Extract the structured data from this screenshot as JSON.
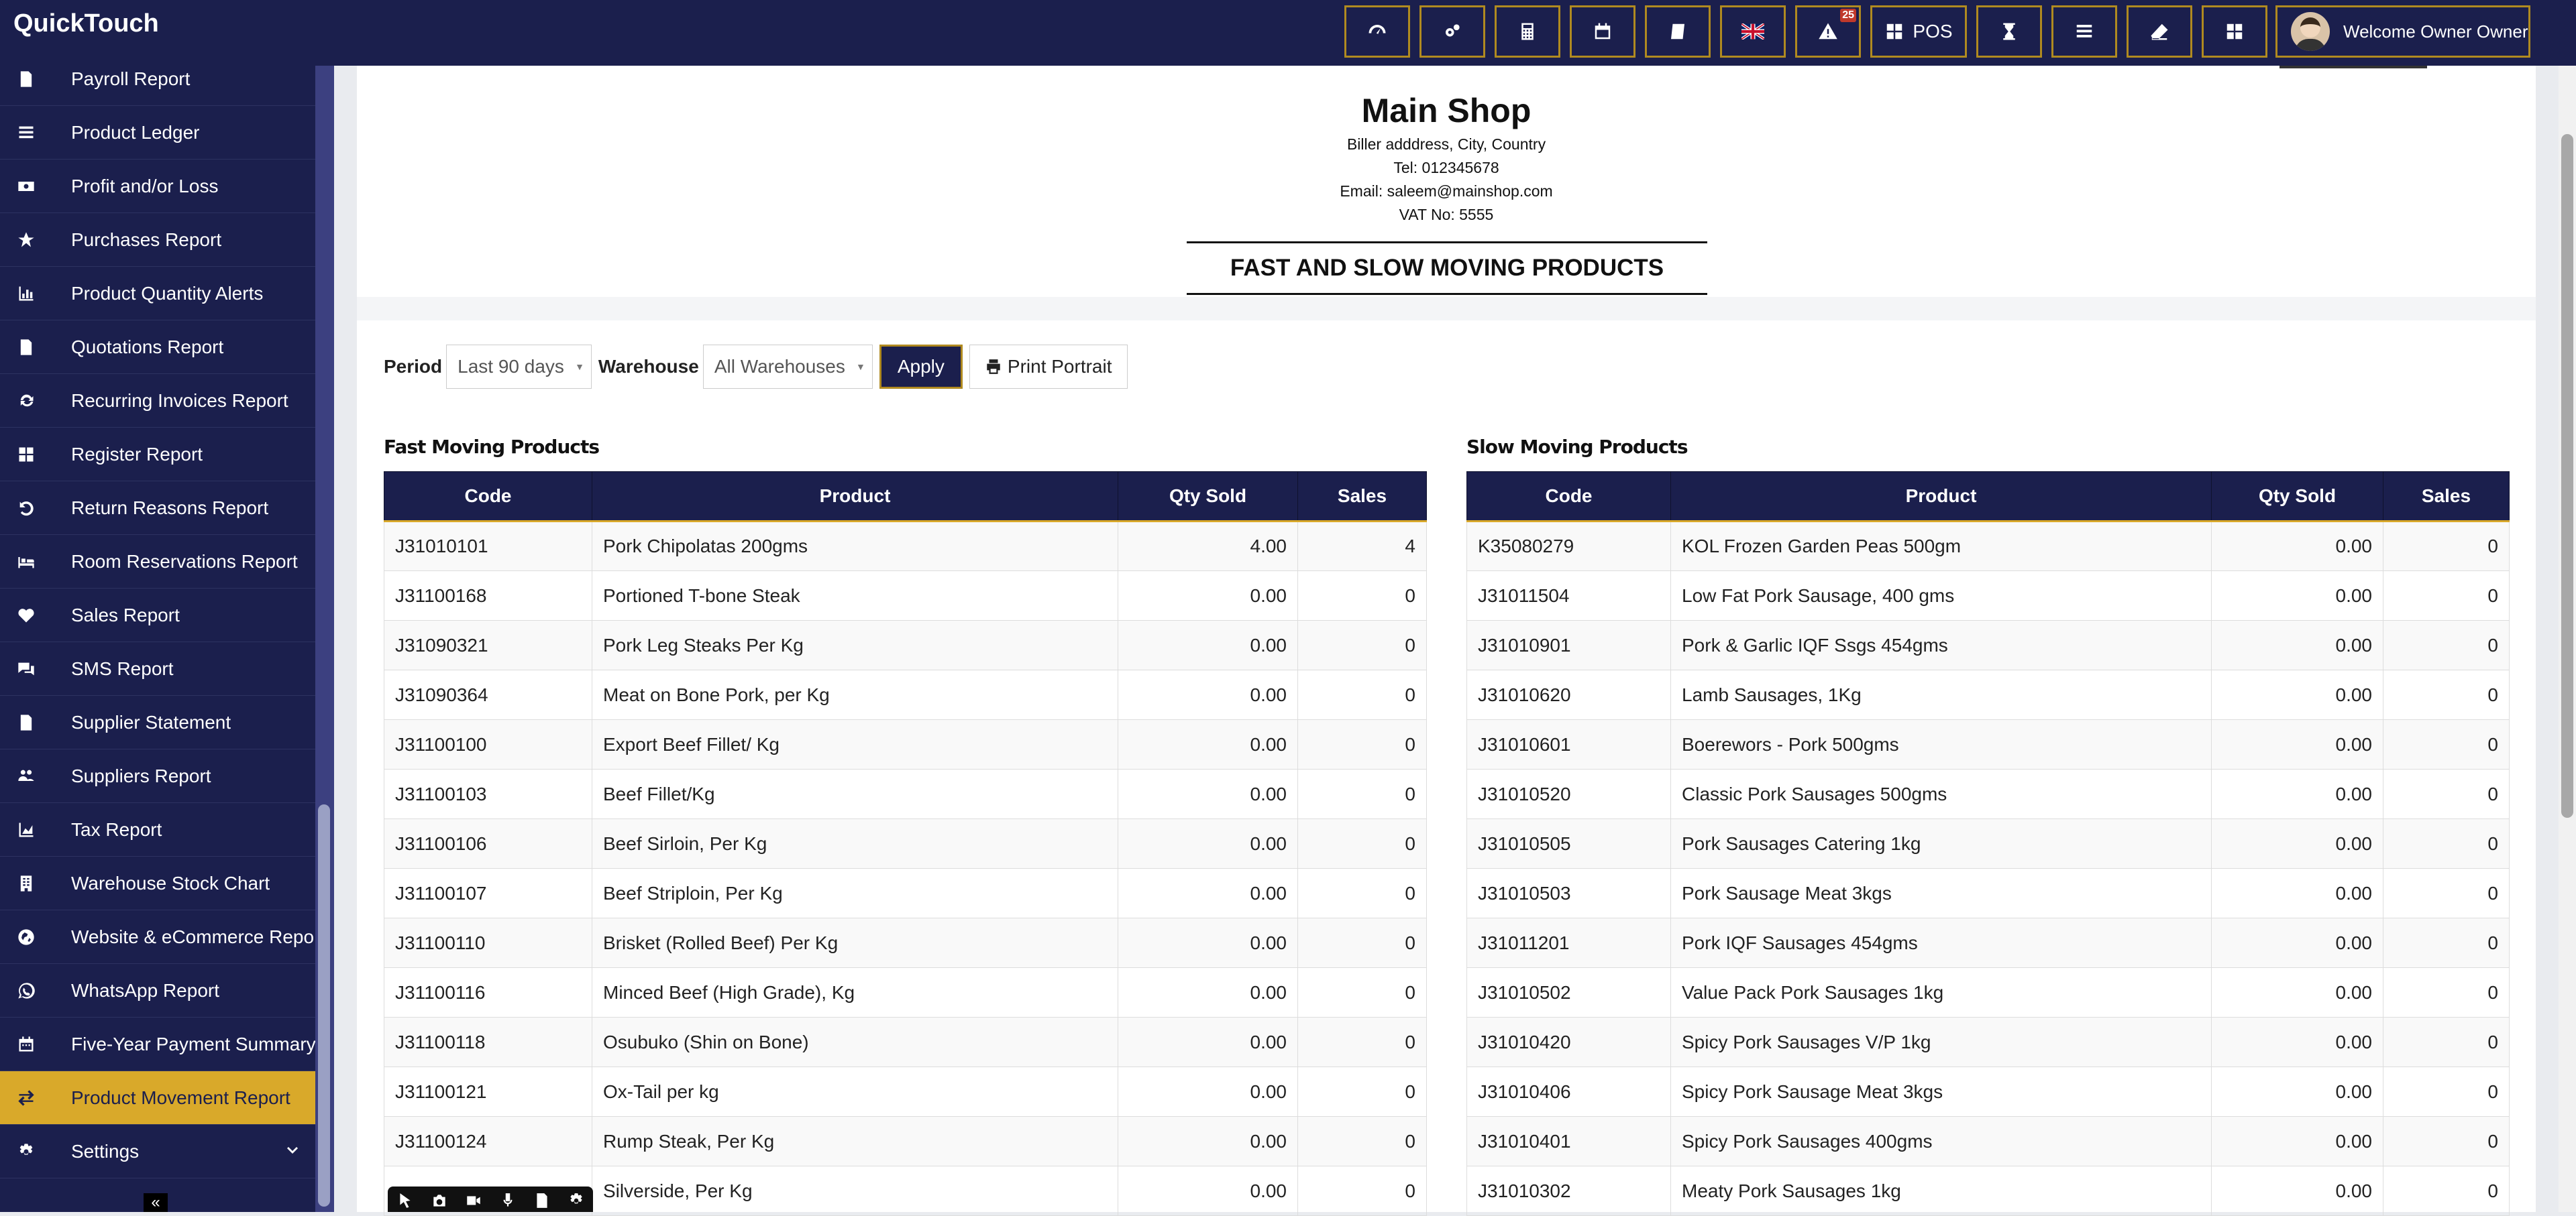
{
  "brand": "QuickTouch",
  "topbar": {
    "pos_label": "POS",
    "alert_badge": "25",
    "welcome": "Welcome Owner Owner"
  },
  "sidebar": {
    "items": [
      {
        "label": "Payroll Report",
        "icon": "file-icon"
      },
      {
        "label": "Product Ledger",
        "icon": "list-icon"
      },
      {
        "label": "Profit and/or Loss",
        "icon": "money-icon"
      },
      {
        "label": "Purchases Report",
        "icon": "star-icon"
      },
      {
        "label": "Product Quantity Alerts",
        "icon": "bar-chart-icon"
      },
      {
        "label": "Quotations Report",
        "icon": "file-icon"
      },
      {
        "label": "Recurring Invoices Report",
        "icon": "refresh-icon"
      },
      {
        "label": "Register Report",
        "icon": "grid-icon"
      },
      {
        "label": "Return Reasons Report",
        "icon": "undo-icon"
      },
      {
        "label": "Room Reservations Report",
        "icon": "bed-icon"
      },
      {
        "label": "Sales Report",
        "icon": "heart-icon"
      },
      {
        "label": "SMS Report",
        "icon": "comments-icon"
      },
      {
        "label": "Supplier Statement",
        "icon": "file-icon"
      },
      {
        "label": "Suppliers Report",
        "icon": "users-icon"
      },
      {
        "label": "Tax Report",
        "icon": "area-chart-icon"
      },
      {
        "label": "Warehouse Stock Chart",
        "icon": "building-icon"
      },
      {
        "label": "Website & eCommerce Repo",
        "icon": "globe-icon"
      },
      {
        "label": "WhatsApp Report",
        "icon": "whatsapp-icon"
      },
      {
        "label": "Five-Year Payment Summary",
        "icon": "calendar-icon"
      },
      {
        "label": "Product Movement Report",
        "icon": "exchange-icon",
        "active": true
      },
      {
        "label": "Settings",
        "icon": "gear-icon"
      }
    ],
    "collapse_label": "«"
  },
  "header": {
    "shop_name": "Main Shop",
    "address": "Biller adddress, City, Country",
    "tel": "Tel: 012345678",
    "email": "Email: saleem@mainshop.com",
    "vat": "VAT No: 5555",
    "report_title": "FAST AND SLOW MOVING PRODUCTS"
  },
  "filters": {
    "period_label": "Period",
    "period_value": "Last 90 days",
    "warehouse_label": "Warehouse",
    "warehouse_value": "All Warehouses",
    "apply_label": "Apply",
    "print_label": "Print Portrait"
  },
  "fast": {
    "title": "Fast Moving Products",
    "columns": [
      "Code",
      "Product",
      "Qty Sold",
      "Sales"
    ],
    "rows": [
      [
        "J31010101",
        "Pork Chipolatas 200gms",
        "4.00",
        "4"
      ],
      [
        "J31100168",
        "Portioned T-bone Steak",
        "0.00",
        "0"
      ],
      [
        "J31090321",
        "Pork Leg Steaks Per Kg",
        "0.00",
        "0"
      ],
      [
        "J31090364",
        "Meat on Bone Pork, per Kg",
        "0.00",
        "0"
      ],
      [
        "J31100100",
        "Export Beef Fillet/ Kg",
        "0.00",
        "0"
      ],
      [
        "J31100103",
        "Beef Fillet/Kg",
        "0.00",
        "0"
      ],
      [
        "J31100106",
        "Beef Sirloin, Per Kg",
        "0.00",
        "0"
      ],
      [
        "J31100107",
        "Beef Striploin, Per Kg",
        "0.00",
        "0"
      ],
      [
        "J31100110",
        "Brisket (Rolled Beef) Per Kg",
        "0.00",
        "0"
      ],
      [
        "J31100116",
        "Minced Beef (High Grade), Kg",
        "0.00",
        "0"
      ],
      [
        "J31100118",
        "Osubuko (Shin on Bone)",
        "0.00",
        "0"
      ],
      [
        "J31100121",
        "Ox-Tail per kg",
        "0.00",
        "0"
      ],
      [
        "J31100124",
        "Rump Steak, Per Kg",
        "0.00",
        "0"
      ],
      [
        "",
        "Silverside, Per Kg",
        "0.00",
        "0"
      ]
    ]
  },
  "slow": {
    "title": "Slow Moving Products",
    "columns": [
      "Code",
      "Product",
      "Qty Sold",
      "Sales"
    ],
    "rows": [
      [
        "K35080279",
        "KOL Frozen Garden Peas 500gm",
        "0.00",
        "0"
      ],
      [
        "J31011504",
        "Low Fat Pork Sausage, 400 gms",
        "0.00",
        "0"
      ],
      [
        "J31010901",
        "Pork & Garlic IQF Ssgs 454gms",
        "0.00",
        "0"
      ],
      [
        "J31010620",
        "Lamb Sausages, 1Kg",
        "0.00",
        "0"
      ],
      [
        "J31010601",
        "Boerewors - Pork 500gms",
        "0.00",
        "0"
      ],
      [
        "J31010520",
        "Classic Pork Sausages 500gms",
        "0.00",
        "0"
      ],
      [
        "J31010505",
        "Pork Sausages Catering 1kg",
        "0.00",
        "0"
      ],
      [
        "J31010503",
        "Pork Sausage Meat 3kgs",
        "0.00",
        "0"
      ],
      [
        "J31011201",
        "Pork IQF Sausages 454gms",
        "0.00",
        "0"
      ],
      [
        "J31010502",
        "Value Pack Pork Sausages 1kg",
        "0.00",
        "0"
      ],
      [
        "J31010420",
        "Spicy Pork Sausages V/P 1kg",
        "0.00",
        "0"
      ],
      [
        "J31010406",
        "Spicy Pork Sausage Meat 3kgs",
        "0.00",
        "0"
      ],
      [
        "J31010401",
        "Spicy Pork Sausages 400gms",
        "0.00",
        "0"
      ],
      [
        "J31010302",
        "Meaty Pork Sausages 1kg",
        "0.00",
        "0"
      ]
    ]
  }
}
